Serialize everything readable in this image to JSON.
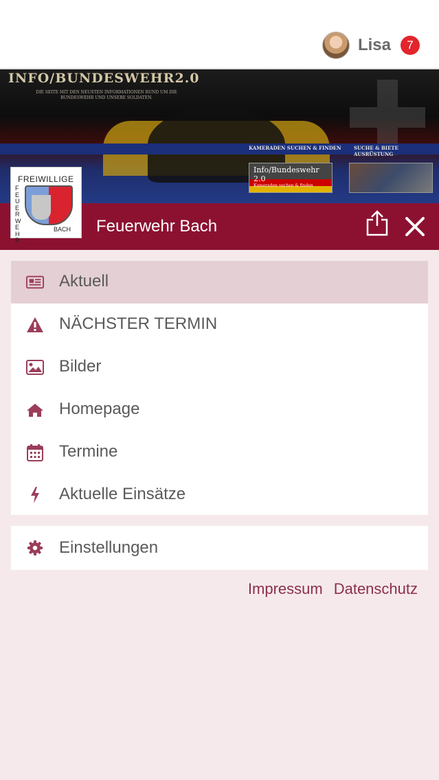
{
  "user": {
    "name": "Lisa",
    "notification_count": "7"
  },
  "banner": {
    "title": "INFO/BUNDESWEHR2.0",
    "subtitle": "DIE SEITE MIT DEN NEUSTEN INFORMATIONEN RUND UM DIE BUNDESWEHR UND UNSERE SOLDATEN.",
    "link_left": "KAMERADEN SUCHEN & FINDEN",
    "link_right": "SUCHE & BIETE AUSRÜSTUNG",
    "thumb_left": "Info/Bundeswehr 2.0",
    "thumb_left_sub": "Kameraden suchen & finden"
  },
  "club": {
    "logo_top": "FREIWILLIGE",
    "logo_side": "FEUERWEHR",
    "logo_bottom": "BACH",
    "title": "Feuerwehr Bach"
  },
  "menu": {
    "items": [
      {
        "label": "Aktuell",
        "icon": "newspaper-icon",
        "active": true
      },
      {
        "label": "NÄCHSTER TERMIN",
        "icon": "warning-icon",
        "active": false
      },
      {
        "label": "Bilder",
        "icon": "image-icon",
        "active": false
      },
      {
        "label": "Homepage",
        "icon": "home-icon",
        "active": false
      },
      {
        "label": "Termine",
        "icon": "calendar-icon",
        "active": false
      },
      {
        "label": "Aktuelle Einsätze",
        "icon": "lightning-icon",
        "active": false
      }
    ],
    "settings_label": "Einstellungen"
  },
  "footer": {
    "impressum": "Impressum",
    "datenschutz": "Datenschutz"
  },
  "colors": {
    "brand": "#8c1131",
    "active_bg": "#e4cfd4",
    "icon": "#9b3e5a",
    "badge": "#e3252d",
    "page_bg": "#f5e9ec"
  }
}
